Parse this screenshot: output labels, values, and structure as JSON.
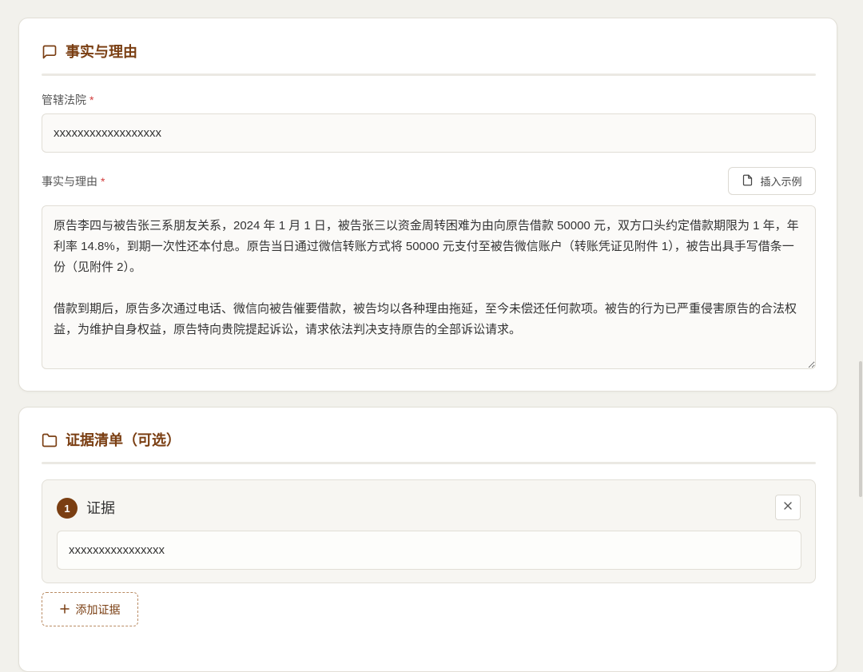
{
  "colors": {
    "page_bg": "#f2f1ec",
    "accent": "#7a3e12",
    "required": "#d23c3c",
    "input_bg": "#fbfaf8"
  },
  "facts_card": {
    "title_icon": "message-square-icon",
    "title": "事实与理由",
    "court_label": "管辖法院",
    "required_mark": "*",
    "court_value": "xxxxxxxxxxxxxxxxxx",
    "facts_label": "事实与理由",
    "insert_example_icon": "file-icon",
    "insert_example_label": "插入示例",
    "facts_value": "原告李四与被告张三系朋友关系，2024 年 1 月 1 日，被告张三以资金周转困难为由向原告借款 50000 元，双方口头约定借款期限为 1 年，年利率 14.8%，到期一次性还本付息。原告当日通过微信转账方式将 50000 元支付至被告微信账户（转账凭证见附件 1），被告出具手写借条一份（见附件 2）。\n\n借款到期后，原告多次通过电话、微信向被告催要借款，被告均以各种理由拖延，至今未偿还任何款项。被告的行为已严重侵害原告的合法权益，为维护自身权益，原告特向贵院提起诉讼，请求依法判决支持原告的全部诉讼请求。"
  },
  "evidence_card": {
    "title_icon": "folder-icon",
    "title": "证据清单（可选）",
    "items": [
      {
        "index": "1",
        "label": "证据",
        "value": "xxxxxxxxxxxxxxxx",
        "remove_icon": "close-icon"
      }
    ],
    "add_icon": "plus-icon",
    "add_label": "添加证据"
  }
}
